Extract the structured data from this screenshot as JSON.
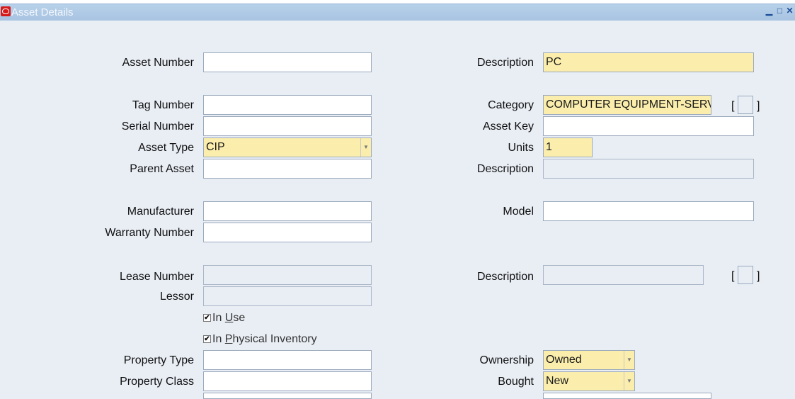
{
  "window": {
    "title": "Asset Details",
    "controls": [
      "minimize",
      "maximize",
      "close"
    ]
  },
  "left": {
    "asset_number": {
      "label": "Asset Number",
      "value": ""
    },
    "tag_number": {
      "label": "Tag Number",
      "value": ""
    },
    "serial_number": {
      "label": "Serial Number",
      "value": ""
    },
    "asset_type": {
      "label": "Asset Type",
      "value": "CIP"
    },
    "parent_asset": {
      "label": "Parent Asset",
      "value": ""
    },
    "manufacturer": {
      "label": "Manufacturer",
      "value": ""
    },
    "warranty_number": {
      "label": "Warranty Number",
      "value": ""
    },
    "lease_number": {
      "label": "Lease Number",
      "value": ""
    },
    "lessor": {
      "label": "Lessor",
      "value": ""
    },
    "in_use": {
      "pre": "In ",
      "accel": "U",
      "post": "se",
      "checked": true
    },
    "in_physical_inventory": {
      "pre": "In ",
      "accel": "P",
      "post": "hysical Inventory",
      "checked": true
    },
    "property_type": {
      "label": "Property Type",
      "value": ""
    },
    "property_class": {
      "label": "Property Class",
      "value": ""
    }
  },
  "right": {
    "description": {
      "label": "Description",
      "value": "PC"
    },
    "category": {
      "label": "Category",
      "value": "COMPUTER EQUIPMENT-SERV"
    },
    "asset_key": {
      "label": "Asset Key",
      "value": ""
    },
    "units": {
      "label": "Units",
      "value": "1"
    },
    "parent_description": {
      "label": "Description",
      "value": ""
    },
    "model": {
      "label": "Model",
      "value": ""
    },
    "lease_description": {
      "label": "Description",
      "value": ""
    },
    "ownership": {
      "label": "Ownership",
      "value": "Owned"
    },
    "bought": {
      "label": "Bought",
      "value": "New"
    }
  },
  "brackets": {
    "open": "[",
    "close": "]"
  },
  "glyphs": {
    "check": "✔",
    "dropdown": "▼",
    "minimize": "▁",
    "maximize": "□",
    "close": "✕"
  },
  "colors": {
    "required_field": "#fbeeac",
    "background": "#e9eef5",
    "titlebar": "#a8c4e2"
  }
}
